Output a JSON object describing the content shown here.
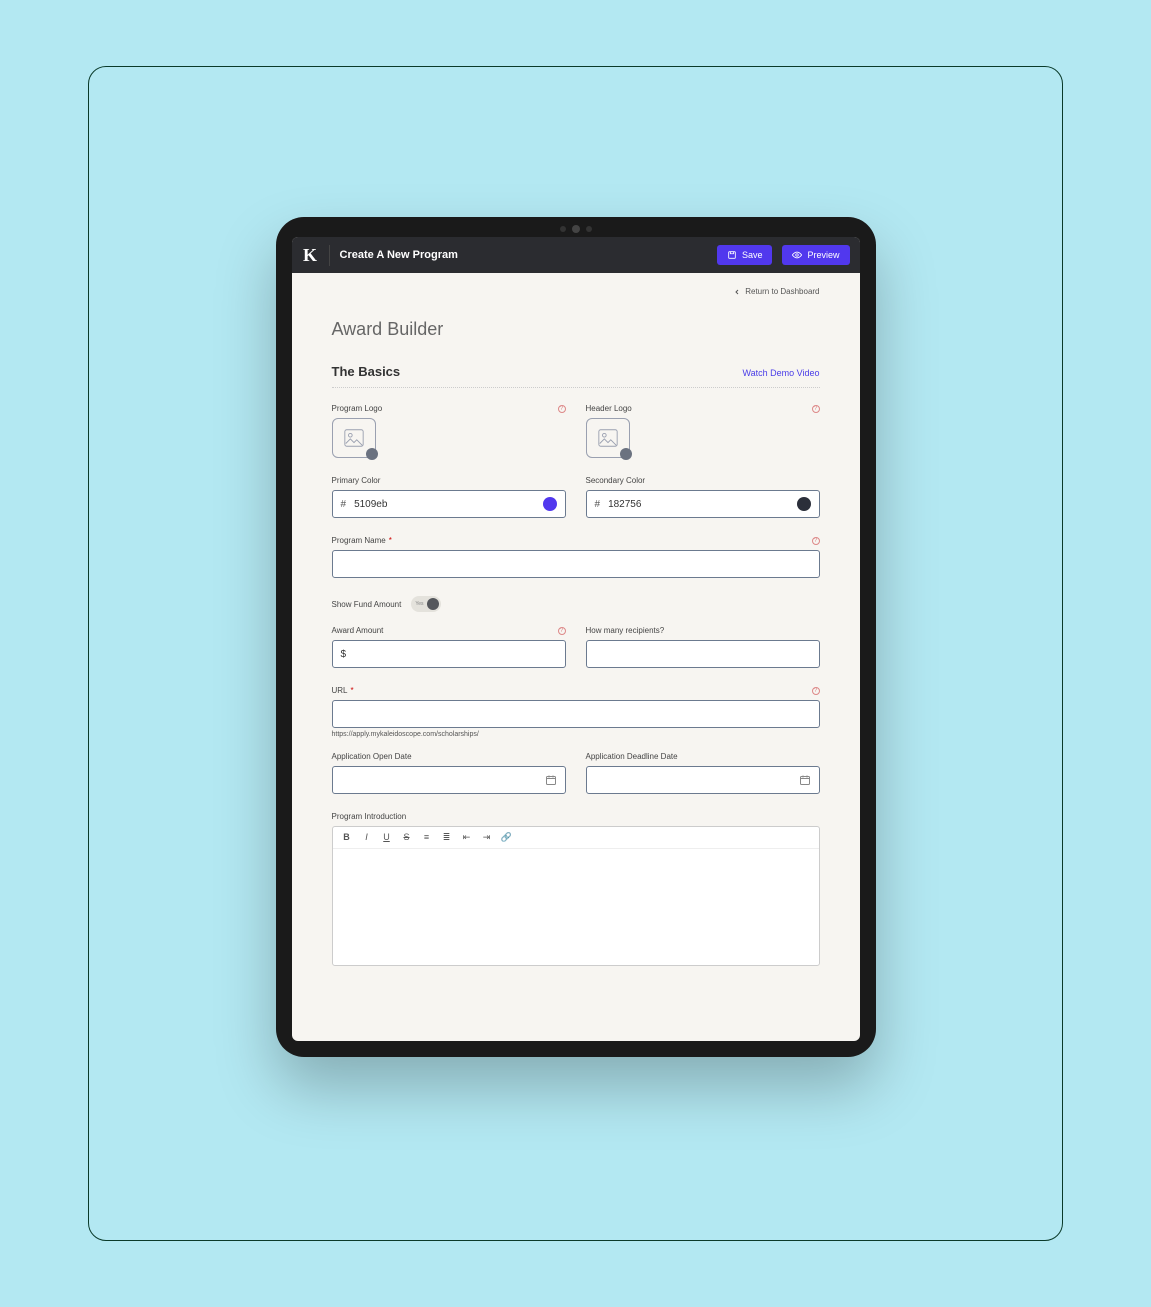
{
  "topbar": {
    "logo_letter": "K",
    "title": "Create A New Program",
    "save": "Save",
    "preview": "Preview"
  },
  "nav": {
    "return": "Return to Dashboard"
  },
  "page": {
    "title": "Award Builder"
  },
  "section": {
    "title": "The Basics",
    "demo_link": "Watch Demo Video"
  },
  "fields": {
    "program_logo": "Program Logo",
    "header_logo": "Header Logo",
    "primary_color": "Primary Color",
    "secondary_color": "Secondary Color",
    "primary_color_value": "5109eb",
    "secondary_color_value": "182756",
    "hash": "#",
    "program_name": "Program Name",
    "show_fund_amount": "Show Fund Amount",
    "toggle_text": "Yes",
    "award_amount": "Award Amount",
    "award_amount_prefix": "$",
    "recipients": "How many recipients?",
    "url": "URL",
    "url_hint": "https://apply.mykaleidoscope.com/scholarships/",
    "open_date": "Application Open Date",
    "deadline_date": "Application Deadline Date",
    "intro": "Program Introduction",
    "required": "*"
  },
  "colors": {
    "primary_swatch": "#5138ee",
    "secondary_swatch": "#2b2f3a"
  },
  "editor_tools": {
    "bold": "B",
    "italic": "I",
    "underline": "U",
    "strike": "S",
    "ul": "≡",
    "ol": "≣",
    "indent_out": "⇤",
    "indent_in": "⇥",
    "link": "🔗"
  }
}
